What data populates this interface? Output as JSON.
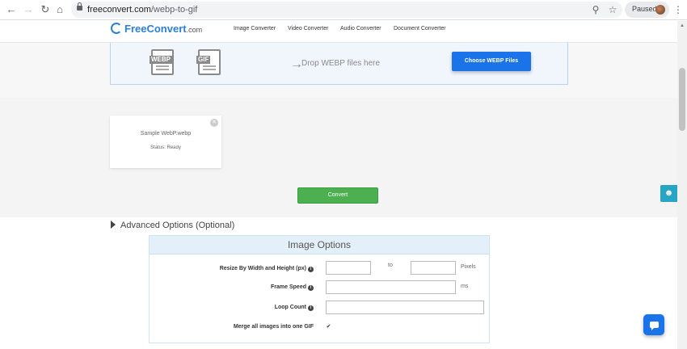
{
  "browser": {
    "url_host": "freeconvert.com",
    "url_path": "/webp-to-gif",
    "profile_status": "Paused",
    "icons": [
      "back-icon",
      "forward-icon",
      "reload-icon",
      "home-icon",
      "lock-icon",
      "zoom-icon",
      "star-icon",
      "menu-dots-icon"
    ]
  },
  "site": {
    "logo_name": "FreeConvert",
    "logo_suffix": ".com",
    "nav": [
      "Image Converter",
      "Video Converter",
      "Audio Converter",
      "Document Converter"
    ],
    "brand_color": "#2b7fd9"
  },
  "dropzone": {
    "from_format": "WEBP",
    "to_format": "GIF",
    "drop_text": "Drop WEBP files here",
    "choose_button": "Choose WEBP Files"
  },
  "file": {
    "name": "Sample WebP.webp",
    "status": "Status: Ready"
  },
  "convert_button": "Convert",
  "advanced": {
    "toggle_label": "Advanced Options (Optional)",
    "panel_title": "Image Options",
    "resize_label": "Resize By Width and Height (px)",
    "resize_to": "to",
    "resize_unit": "Pixels",
    "frame_speed_label": "Frame Speed",
    "frame_speed_unit": "ms",
    "loop_count_label": "Loop Count",
    "merge_label": "Merge all images into one GIF",
    "merge_checked": true
  },
  "colors": {
    "primary_button": "#1a73e8",
    "convert_button": "#4caf50",
    "feedback_tab": "#26a5c4"
  }
}
